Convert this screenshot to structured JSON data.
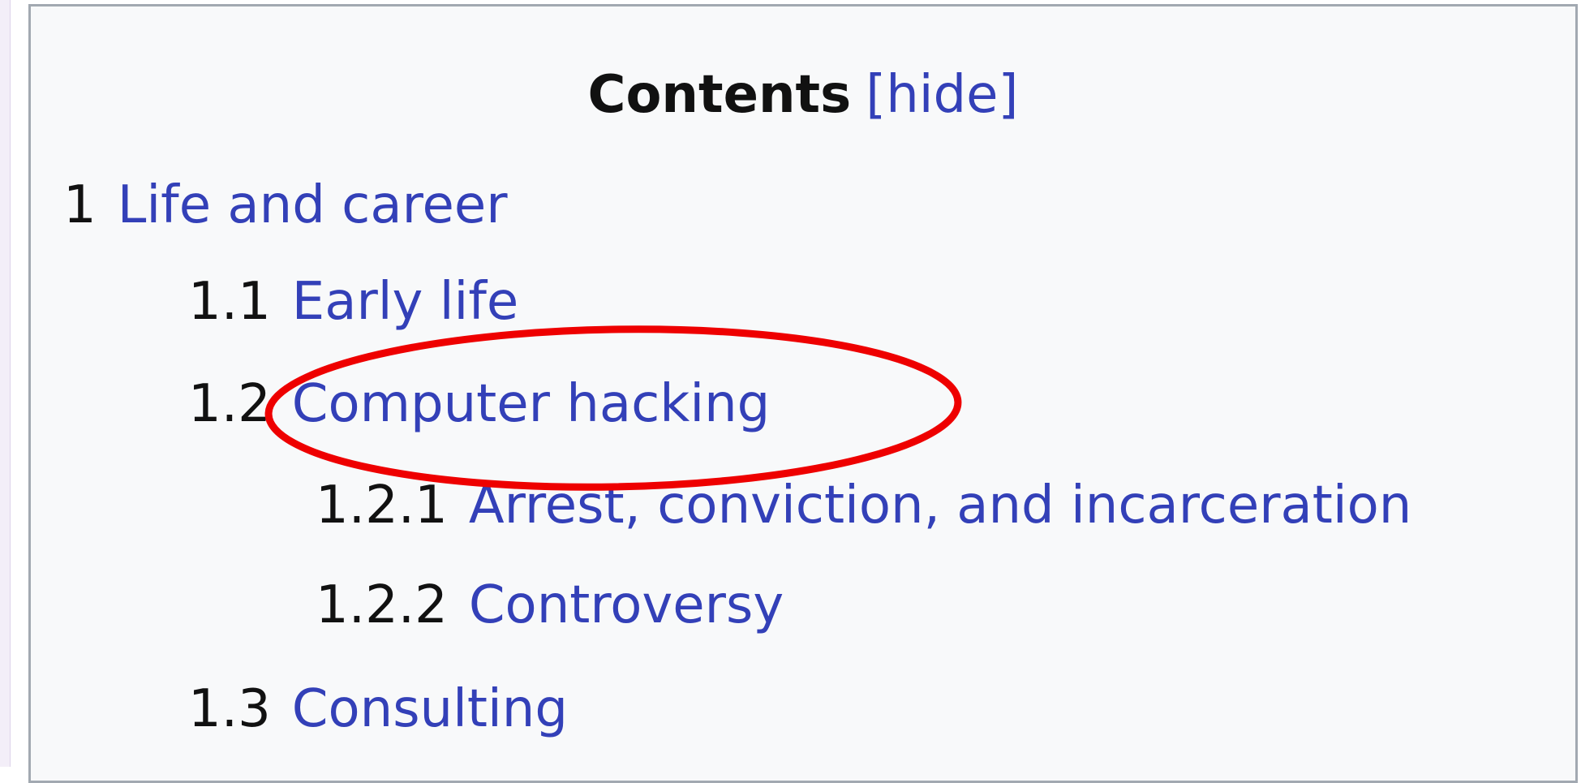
{
  "toc": {
    "title": "Contents",
    "toggle_open": "[",
    "toggle_label": "hide",
    "toggle_close": "]",
    "items": [
      {
        "number": "1",
        "label": "Life and career",
        "level": 1
      },
      {
        "number": "1.1",
        "label": "Early life",
        "level": 2
      },
      {
        "number": "1.2",
        "label": "Computer hacking",
        "level": 2,
        "highlighted": true
      },
      {
        "number": "1.2.1",
        "label": "Arrest, conviction, and incarceration",
        "level": 3
      },
      {
        "number": "1.2.2",
        "label": "Controversy",
        "level": 3
      },
      {
        "number": "1.3",
        "label": "Consulting",
        "level": 2
      }
    ]
  },
  "annotation": {
    "shape": "ellipse",
    "color": "#ee0000",
    "target": "1.2 Computer hacking"
  },
  "colors": {
    "link": "#3340b8",
    "text": "#111111",
    "panel_background": "#f8f9fa",
    "panel_border": "#a2a9b1"
  }
}
